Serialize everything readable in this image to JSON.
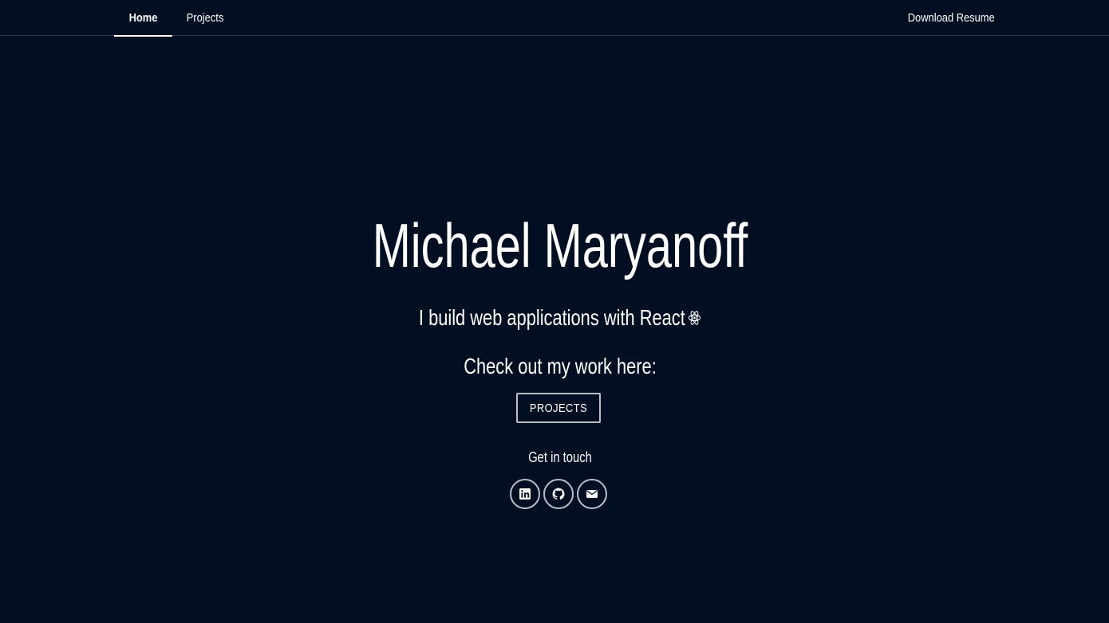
{
  "nav": {
    "home_label": "Home",
    "projects_label": "Projects",
    "resume_label": "Download Resume",
    "active_tab": "Home"
  },
  "hero": {
    "name": "Michael Maryanoff",
    "tagline": "I build web applications with React",
    "tagline_icon": "react-atom-icon",
    "cta_text": "Check out my work here:",
    "projects_button_label": "PROJECTS",
    "contact_heading": "Get in touch"
  },
  "socials": [
    {
      "name": "linkedin",
      "icon": "linkedin-icon"
    },
    {
      "name": "github",
      "icon": "github-icon"
    },
    {
      "name": "email",
      "icon": "envelope-icon"
    }
  ],
  "colors": {
    "background": "#020f22",
    "text": "#ffffff",
    "border": "#b9bec6",
    "nav_divider": "#2a3442"
  }
}
